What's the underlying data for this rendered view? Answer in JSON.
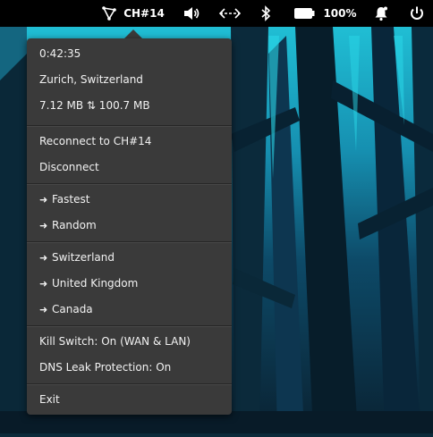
{
  "topbar": {
    "vpn_label": "CH#14",
    "battery_text": "100%",
    "icons": [
      "vpn-triangle-icon",
      "volume-icon",
      "network-arrows-icon",
      "bluetooth-icon",
      "battery-icon",
      "notification-bell-icon",
      "power-icon"
    ]
  },
  "menu": {
    "status": {
      "elapsed": "0:42:35",
      "location": "Zurich, Switzerland",
      "traffic": "7.12 MB ⇅ 100.7 MB"
    },
    "connection": {
      "reconnect": "Reconnect to CH#14",
      "disconnect": "Disconnect"
    },
    "quick": [
      {
        "label": "Fastest"
      },
      {
        "label": "Random"
      }
    ],
    "countries": [
      {
        "label": "Switzerland"
      },
      {
        "label": "United Kingdom"
      },
      {
        "label": "Canada"
      }
    ],
    "settings": {
      "kill_switch": "Kill Switch: On (WAN & LAN)",
      "dns_leak": "DNS Leak Protection: On"
    },
    "exit": "Exit",
    "arrow_glyph": "➜"
  },
  "colors": {
    "menu_bg": "#3a3a3a",
    "topbar_bg": "#000000",
    "wallpaper_cyan": "#1ec9dd",
    "wallpaper_dark": "#0c2a3a"
  }
}
